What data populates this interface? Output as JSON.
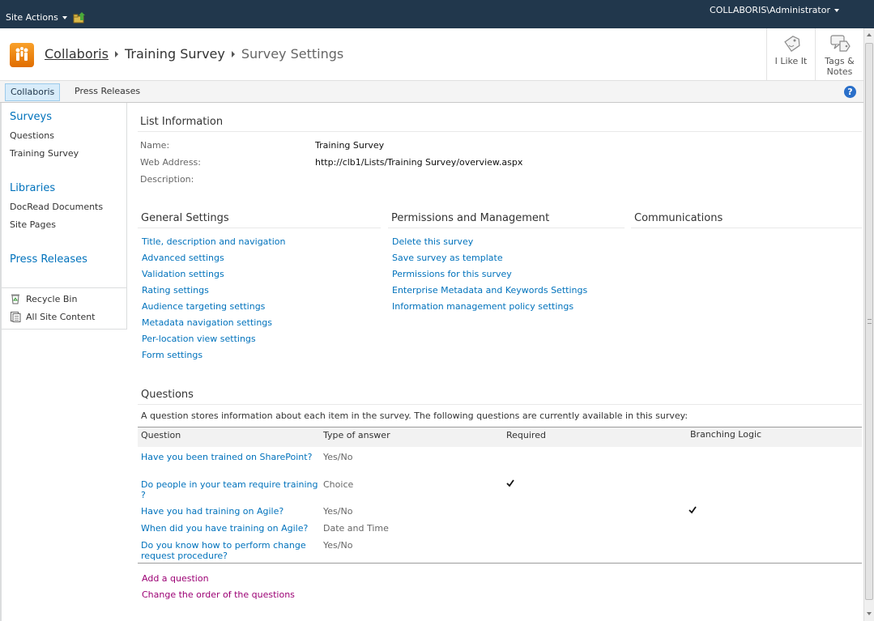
{
  "topbar": {
    "site_actions": "Site Actions",
    "user": "COLLABORIS\\Administrator"
  },
  "breadcrumb": {
    "site": "Collaboris",
    "list": "Training Survey",
    "page": "Survey Settings"
  },
  "ribbon": {
    "like": "I Like It",
    "tags_line1": "Tags &",
    "tags_line2": "Notes"
  },
  "topnav": {
    "items": [
      "Collaboris",
      "Press Releases"
    ],
    "help": "?"
  },
  "leftnav": {
    "surveys_head": "Surveys",
    "surveys": [
      "Questions",
      "Training Survey"
    ],
    "libraries_head": "Libraries",
    "libraries": [
      "DocRead Documents",
      "Site Pages"
    ],
    "press_head": "Press Releases",
    "recycle": "Recycle Bin",
    "all_content": "All Site Content"
  },
  "list_info": {
    "heading": "List Information",
    "name_label": "Name:",
    "name_value": "Training Survey",
    "web_label": "Web Address:",
    "web_value": "http://clb1/Lists/Training Survey/overview.aspx",
    "desc_label": "Description:"
  },
  "general": {
    "heading": "General Settings",
    "links": [
      "Title, description and navigation",
      "Advanced settings",
      "Validation settings",
      "Rating settings",
      "Audience targeting settings",
      "Metadata navigation settings",
      "Per-location view settings",
      "Form settings"
    ]
  },
  "permissions": {
    "heading": "Permissions and Management",
    "links": [
      "Delete this survey",
      "Save survey as template",
      "Permissions for this survey",
      "Enterprise Metadata and Keywords Settings",
      "Information management policy settings"
    ]
  },
  "communications": {
    "heading": "Communications"
  },
  "questions": {
    "heading": "Questions",
    "description": "A question stores information about each item in the survey. The following questions are currently available in this survey:",
    "columns": [
      "Question",
      "Type of answer",
      "Required",
      "Branching Logic"
    ],
    "rows": [
      {
        "question": "Have you been trained on SharePoint?",
        "type": "Yes/No",
        "required": false,
        "branching": false
      },
      {
        "question": "Do people in your team require training ?",
        "type": "Choice",
        "required": true,
        "branching": false
      },
      {
        "question": "Have you had training on Agile?",
        "type": "Yes/No",
        "required": false,
        "branching": true
      },
      {
        "question": "When did you have training on Agile?",
        "type": "Date and Time",
        "required": false,
        "branching": false
      },
      {
        "question": "Do you know how to perform change request procedure?",
        "type": "Yes/No",
        "required": false,
        "branching": false
      }
    ],
    "add_link": "Add a question",
    "order_link": "Change the order of the questions"
  },
  "colors": {
    "topbar": "#21374c",
    "link": "#0072bc",
    "visited_link": "#9c0074"
  }
}
